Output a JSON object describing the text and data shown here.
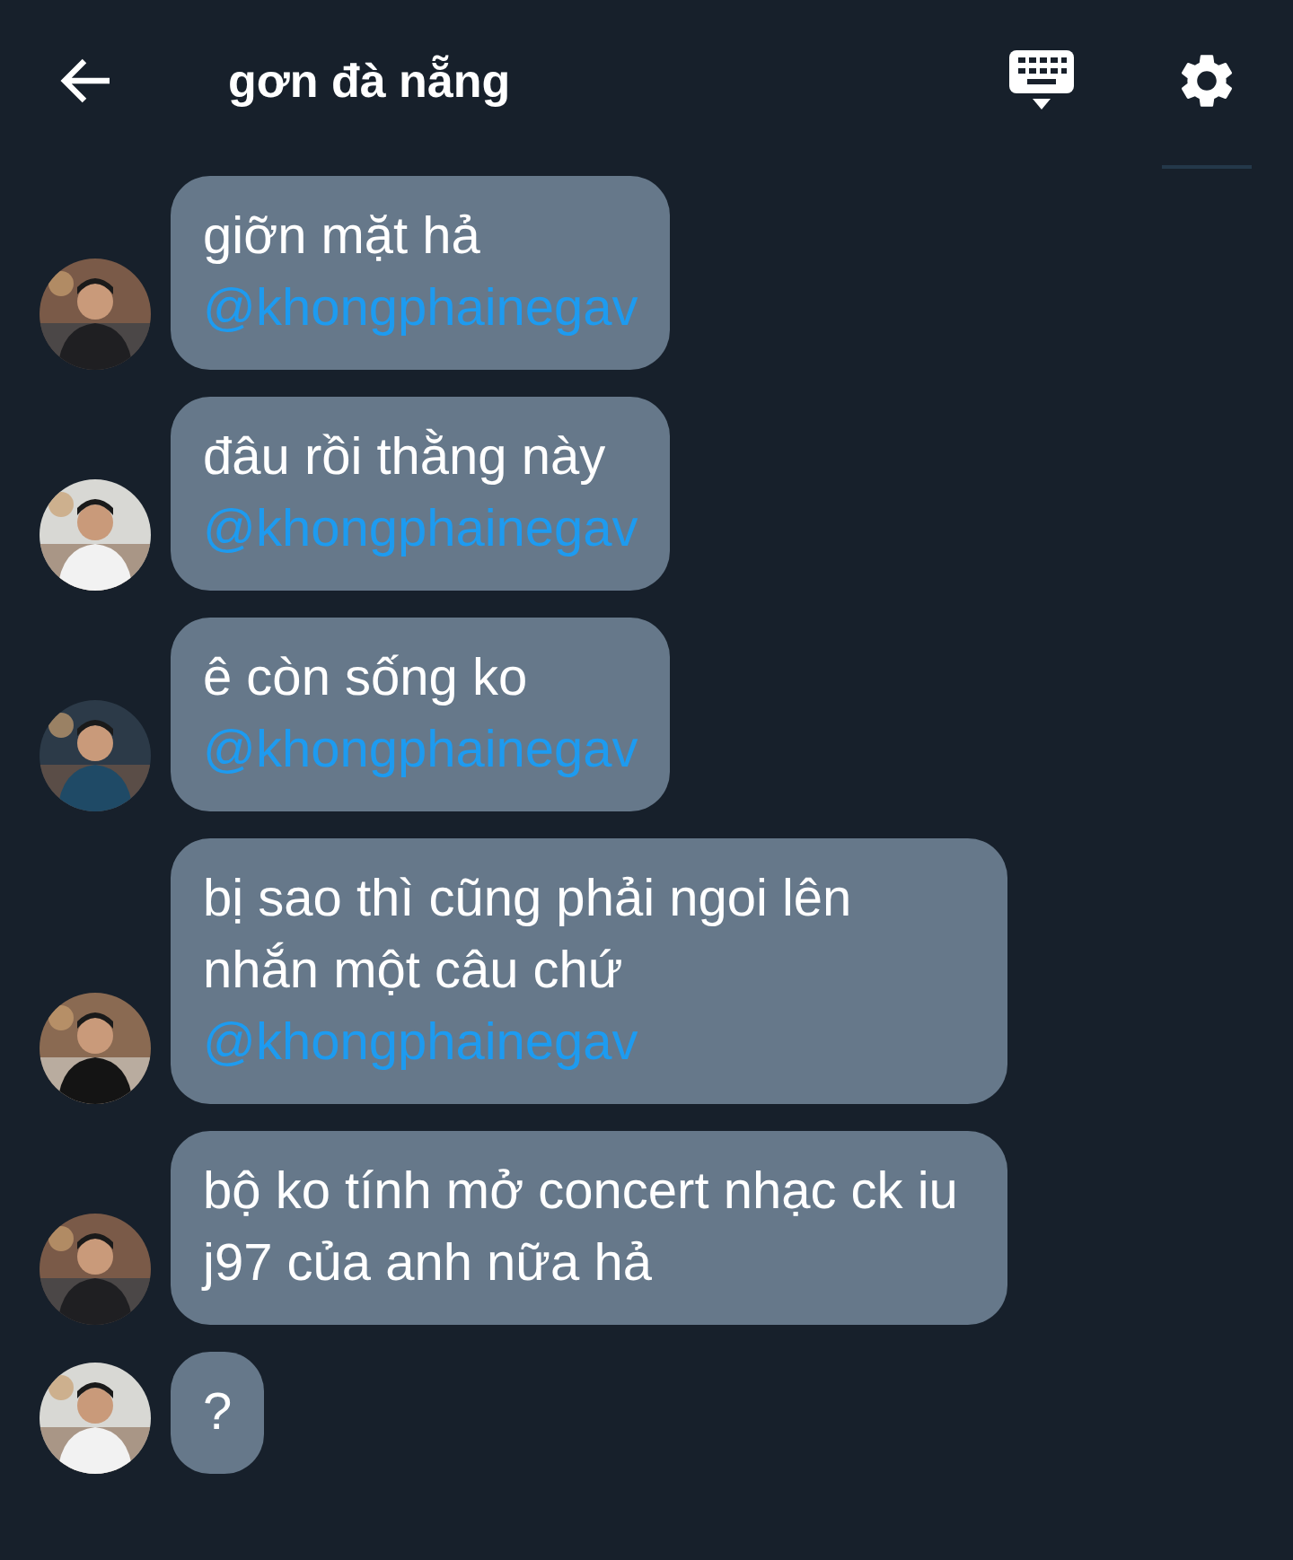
{
  "header": {
    "title": "gơn đà nẵng"
  },
  "messages": [
    {
      "text": "giỡn mặt hả",
      "mention": "@khongphainegav"
    },
    {
      "text": "đâu rồi thằng này",
      "mention": "@khongphainegav"
    },
    {
      "text": "ê còn sống ko",
      "mention": "@khongphainegav"
    },
    {
      "text": "bị sao thì cũng phải ngoi lên nhắn một câu chứ",
      "mention": "@khongphainegav"
    },
    {
      "text": "bộ ko tính mở concert nhạc ck iu j97 của anh nữa hả"
    },
    {
      "text": "?"
    }
  ]
}
